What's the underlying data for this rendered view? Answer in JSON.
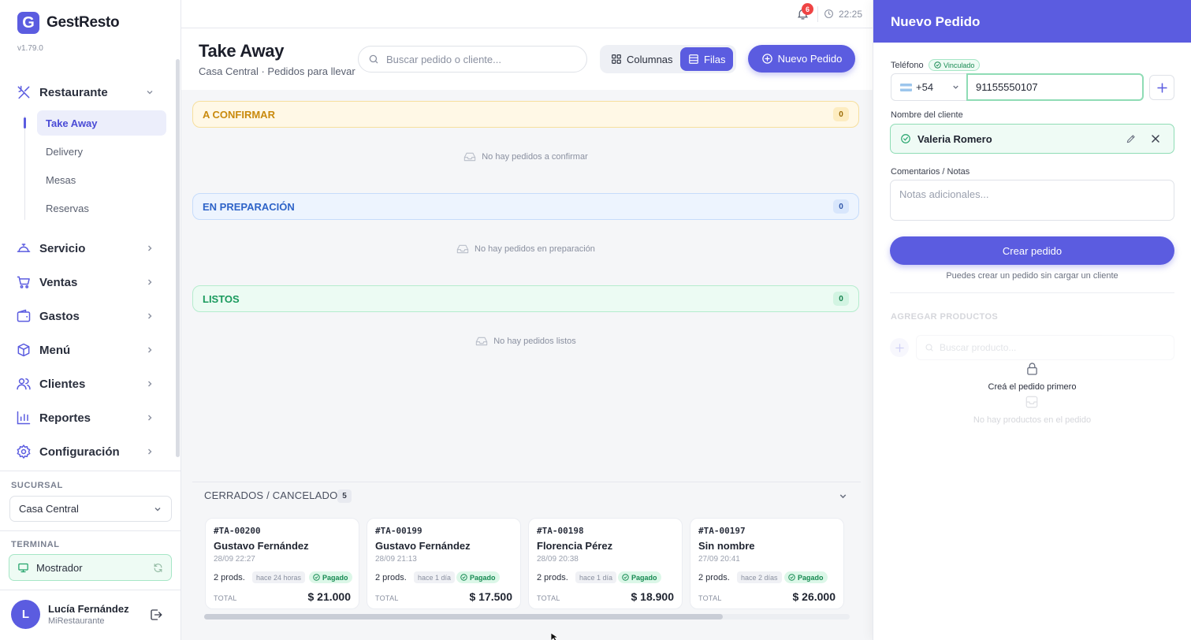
{
  "app": {
    "name": "GestResto",
    "logo_letter": "G",
    "version": "v1.79.0",
    "accent": "#5b5ce0"
  },
  "sidebar": {
    "groups": [
      {
        "label": "Restaurante",
        "icon": "utensils-icon",
        "expanded": true
      },
      {
        "label": "Servicio",
        "icon": "service-bell-icon"
      },
      {
        "label": "Ventas",
        "icon": "cart-icon"
      },
      {
        "label": "Gastos",
        "icon": "wallet-icon"
      },
      {
        "label": "Menú",
        "icon": "box-icon"
      },
      {
        "label": "Clientes",
        "icon": "users-icon"
      },
      {
        "label": "Reportes",
        "icon": "bar-chart-icon"
      },
      {
        "label": "Configuración",
        "icon": "gear-icon"
      }
    ],
    "subitems": [
      {
        "label": "Take Away",
        "active": true
      },
      {
        "label": "Delivery"
      },
      {
        "label": "Mesas"
      },
      {
        "label": "Reservas"
      }
    ],
    "branch_label": "SUCURSAL",
    "branch_value": "Casa Central",
    "terminal_label": "TERMINAL",
    "terminal_value": "Mostrador",
    "user": {
      "initial": "L",
      "name": "Lucía Fernández",
      "org": "MiRestaurante"
    }
  },
  "topbar": {
    "notifications": "6",
    "time": "22:25"
  },
  "header": {
    "title": "Take Away",
    "subtitle": "Casa Central · Pedidos para llevar",
    "search_placeholder": "Buscar pedido o cliente...",
    "view_columns": "Columnas",
    "view_rows": "Filas",
    "active_view": "Filas",
    "new_order": "Nuevo Pedido"
  },
  "sections": [
    {
      "title": "A CONFIRMAR",
      "count": "0",
      "empty": "No hay pedidos a confirmar"
    },
    {
      "title": "EN PREPARACIÓN",
      "count": "0",
      "empty": "No hay pedidos en preparación"
    },
    {
      "title": "LISTOS",
      "count": "0",
      "empty": "No hay pedidos listos"
    }
  ],
  "closed": {
    "title": "CERRADOS / CANCELADOS",
    "count": "5",
    "orders": [
      {
        "id": "#TA-00200",
        "name": "Gustavo Fernández",
        "date": "28/09 22:27",
        "prods": "2 prods.",
        "ago": "hace 24 horas",
        "status": "Pagado",
        "total_label": "TOTAL",
        "total": "$ 21.000"
      },
      {
        "id": "#TA-00199",
        "name": "Gustavo Fernández",
        "date": "28/09 21:13",
        "prods": "2 prods.",
        "ago": "hace 1 día",
        "status": "Pagado",
        "total_label": "TOTAL",
        "total": "$ 17.500"
      },
      {
        "id": "#TA-00198",
        "name": "Florencia Pérez",
        "date": "28/09 20:38",
        "prods": "2 prods.",
        "ago": "hace 1 día",
        "status": "Pagado",
        "total_label": "TOTAL",
        "total": "$ 18.900"
      },
      {
        "id": "#TA-00197",
        "name": "Sin nombre",
        "date": "27/09 20:41",
        "prods": "2 prods.",
        "ago": "hace 2 días",
        "status": "Pagado",
        "total_label": "TOTAL",
        "total": "$ 26.000"
      }
    ]
  },
  "panel": {
    "title": "Nuevo Pedido",
    "phone_label": "Teléfono",
    "linked_badge": "Vinculado",
    "country_code": "+54",
    "phone_value": "91155550107",
    "client_label": "Nombre del cliente",
    "client_value": "Valeria Romero",
    "notes_label": "Comentarios / Notas",
    "notes_placeholder": "Notas adicionales...",
    "create_button": "Crear pedido",
    "hint": "Puedes crear un pedido sin cargar un cliente",
    "add_products_title": "AGREGAR PRODUCTOS",
    "product_search_placeholder": "Buscar producto...",
    "locked_message": "Creá el pedido primero",
    "no_products": "No hay productos en el pedido"
  }
}
